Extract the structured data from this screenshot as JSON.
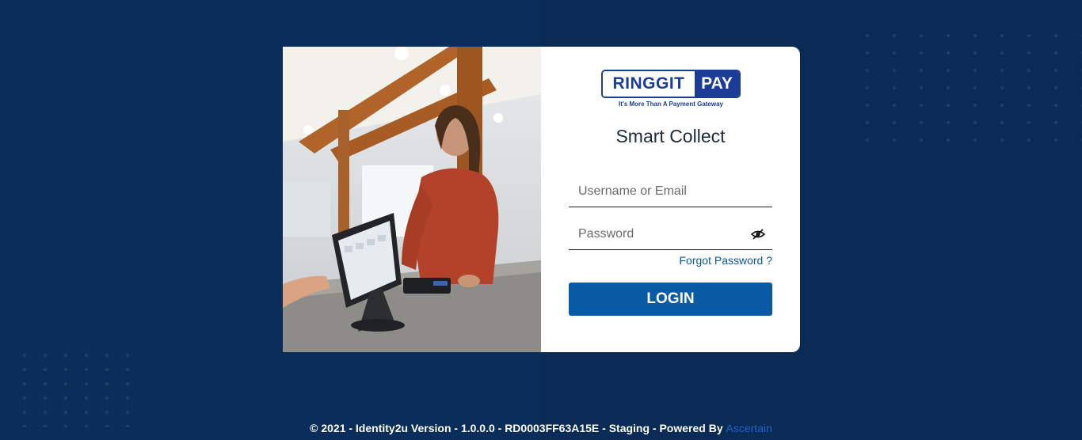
{
  "brand": {
    "logo_word": "RINGGIT",
    "logo_word2": "PAY",
    "tagline": "It's More Than A Payment Gateway"
  },
  "app_title": "Smart Collect",
  "form": {
    "username_placeholder": "Username or Email",
    "username_value": "",
    "password_placeholder": "Password",
    "password_value": "",
    "forgot_label": "Forgot Password ?",
    "login_label": "LOGIN"
  },
  "icons": {
    "password_toggle": "eye-slash-icon"
  },
  "footer": {
    "text": "© 2021 - Identity2u Version - 1.0.0.0 - RD0003FF63A15E - Staging - Powered By ",
    "link_label": "Ascertain"
  },
  "colors": {
    "background": "#0b2d5a",
    "primary": "#0a5aa6",
    "logo_blue": "#1b3d96",
    "link": "#0a56a3"
  }
}
